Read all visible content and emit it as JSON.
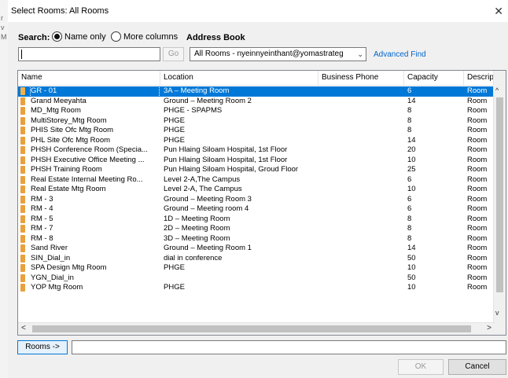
{
  "window": {
    "title": "Select Rooms: All Rooms",
    "close_glyph": "✕"
  },
  "background_fragments": [
    "r",
    "v",
    "M"
  ],
  "search": {
    "label": "Search:",
    "radio_name_only": "Name only",
    "radio_more_columns": "More columns",
    "selected_option": "Name only",
    "input_value": "",
    "go_label": "Go"
  },
  "address_book": {
    "label": "Address Book",
    "selected": "All Rooms - nyeinnyeinthant@yomastrateg",
    "advanced_find": "Advanced Find"
  },
  "table": {
    "columns": [
      "Name",
      "Location",
      "Business Phone",
      "Capacity",
      "Descrip"
    ],
    "selected_row": 0,
    "rows": [
      {
        "name": "GR - 01",
        "location": "3A – Meeting Room",
        "phone": "",
        "capacity": "6",
        "description": "Room"
      },
      {
        "name": "Grand Meeyahta",
        "location": "Ground – Meeting Room 2",
        "phone": "",
        "capacity": "14",
        "description": "Room"
      },
      {
        "name": "MD_Mtg Room",
        "location": "PHGE - SPAPMS",
        "phone": "",
        "capacity": "8",
        "description": "Room"
      },
      {
        "name": "MultiStorey_Mtg Room",
        "location": "PHGE",
        "phone": "",
        "capacity": "8",
        "description": "Room"
      },
      {
        "name": "PHIS Site Ofc Mtg Room",
        "location": "PHGE",
        "phone": "",
        "capacity": "8",
        "description": "Room"
      },
      {
        "name": "PHL Site Ofc Mtg Room",
        "location": "PHGE",
        "phone": "",
        "capacity": "14",
        "description": "Room"
      },
      {
        "name": "PHSH Conference Room (Specia...",
        "location": "Pun Hlaing Siloam Hospital, 1st Floor",
        "phone": "",
        "capacity": "20",
        "description": "Room"
      },
      {
        "name": "PHSH Executive Office Meeting ...",
        "location": "Pun Hlaing Siloam Hospital, 1st Floor",
        "phone": "",
        "capacity": "10",
        "description": "Room"
      },
      {
        "name": "PHSH Training Room",
        "location": "Pun Hlaing Siloam Hospital, Groud Floor",
        "phone": "",
        "capacity": "25",
        "description": "Room"
      },
      {
        "name": "Real Estate Internal Meeting Ro...",
        "location": "Level 2-A,The Campus",
        "phone": "",
        "capacity": "6",
        "description": "Room"
      },
      {
        "name": "Real Estate Mtg Room",
        "location": "Level 2-A, The Campus",
        "phone": "",
        "capacity": "10",
        "description": "Room"
      },
      {
        "name": "RM - 3",
        "location": "Ground – Meeting Room 3",
        "phone": "",
        "capacity": "6",
        "description": "Room"
      },
      {
        "name": "RM - 4",
        "location": "Ground – Meeting room 4",
        "phone": "",
        "capacity": "6",
        "description": "Room"
      },
      {
        "name": "RM - 5",
        "location": "1D – Meeting Room",
        "phone": "",
        "capacity": "8",
        "description": "Room"
      },
      {
        "name": "RM - 7",
        "location": "2D – Meeting Room",
        "phone": "",
        "capacity": "8",
        "description": "Room"
      },
      {
        "name": "RM - 8",
        "location": "3D – Meeting Room",
        "phone": "",
        "capacity": "8",
        "description": "Room"
      },
      {
        "name": "Sand River",
        "location": "Ground – Meeting Room 1",
        "phone": "",
        "capacity": "14",
        "description": "Room"
      },
      {
        "name": "SIN_Dial_in",
        "location": "dial in conference",
        "phone": "",
        "capacity": "50",
        "description": "Room"
      },
      {
        "name": "SPA Design Mtg Room",
        "location": "PHGE",
        "phone": "",
        "capacity": "10",
        "description": "Room"
      },
      {
        "name": "YGN_Dial_in",
        "location": "",
        "phone": "",
        "capacity": "50",
        "description": "Room"
      },
      {
        "name": "YOP Mtg Room",
        "location": "PHGE",
        "phone": "",
        "capacity": "10",
        "description": "Room"
      }
    ]
  },
  "scroll_glyphs": {
    "up": "^",
    "down": "v",
    "left": "<",
    "right": ">"
  },
  "footer": {
    "rooms_button": "Rooms ->",
    "rooms_value": "",
    "ok_label": "OK",
    "cancel_label": "Cancel"
  },
  "colors": {
    "selection": "#0078d7",
    "link": "#0066cc",
    "room_icon": "#e8a13d"
  }
}
